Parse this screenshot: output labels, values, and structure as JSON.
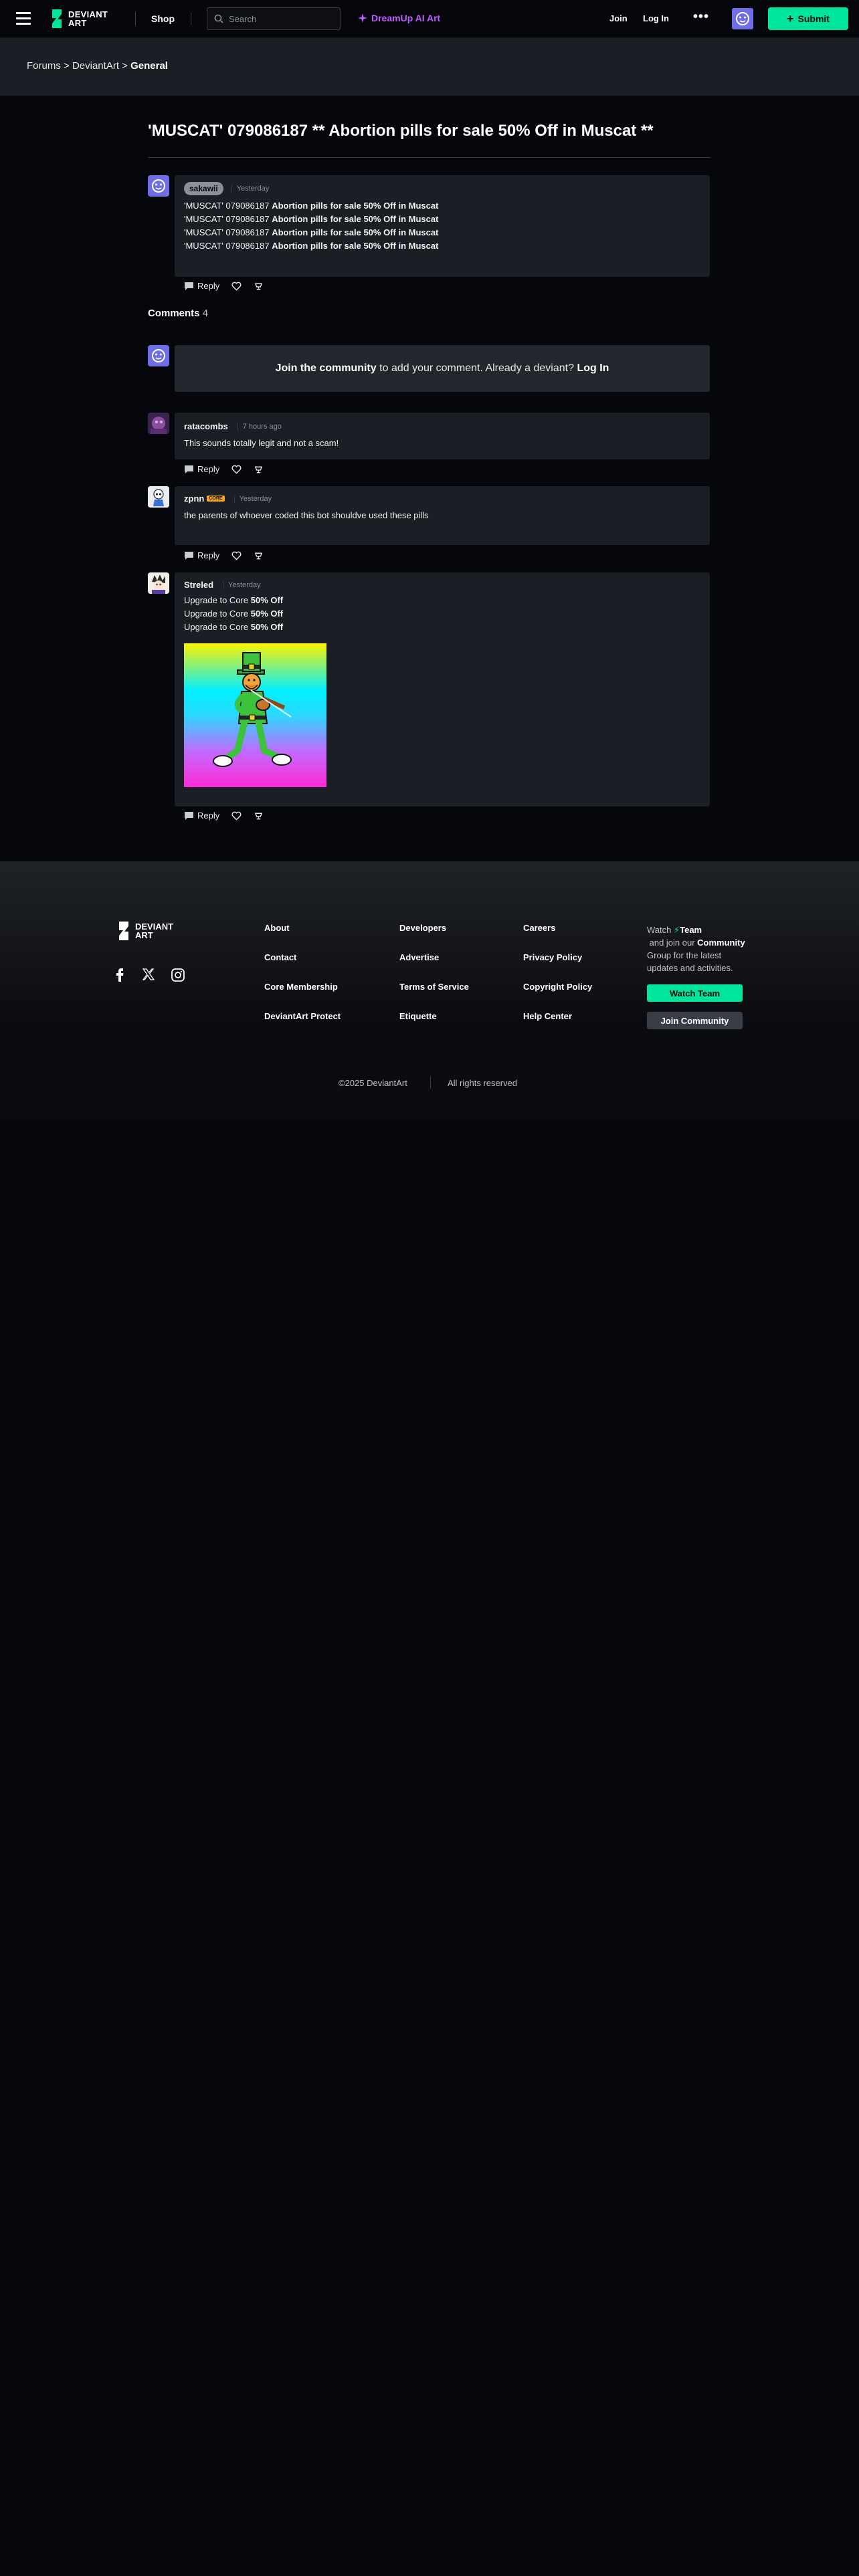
{
  "nav": {
    "shop": "Shop",
    "search_placeholder": "Search",
    "dreamup": "DreamUp AI Art",
    "join": "Join",
    "login": "Log In",
    "more": "•••",
    "submit": "Submit",
    "logo_line1": "DEVIANT",
    "logo_line2": "ART"
  },
  "breadcrumb": {
    "items": [
      "Forums",
      "DeviantArt"
    ],
    "sep": " > ",
    "current": "General"
  },
  "post": {
    "title": "'MUSCAT' 079086187 ** Abortion pills for sale 50% Off in Muscat **",
    "author": "sakawii",
    "time": "Yesterday",
    "lines": [
      {
        "prefix": "'MUSCAT' 079086187",
        "bold": "Abortion pills for sale 50% Off in Muscat"
      },
      {
        "prefix": "'MUSCAT' 079086187",
        "bold": "Abortion pills for sale 50% Off in Muscat"
      },
      {
        "prefix": "'MUSCAT' 079086187",
        "bold": "Abortion pills for sale 50% Off in Muscat"
      },
      {
        "prefix": "'MUSCAT' 079086187",
        "bold": "Abortion pills for sale 50% Off in Muscat"
      }
    ],
    "reply": "Reply"
  },
  "comments": {
    "heading": "Comments",
    "count": "4",
    "join_bold": "Join the community",
    "join_text": " to add your comment. Already a deviant? ",
    "join_login": "Log In",
    "items": [
      {
        "author": "ratacombs",
        "time": "7 hours ago",
        "text": "This sounds totally legit and not a scam!",
        "reply": "Reply"
      },
      {
        "author": "zpnn",
        "badge": "CORE",
        "time": "Yesterday",
        "text": "the parents of whoever coded this bot shouldve used these pills",
        "reply": "Reply"
      },
      {
        "author": "Streled",
        "time": "Yesterday",
        "lines": [
          {
            "prefix": "Upgrade to Core ",
            "bold": "50% Off"
          },
          {
            "prefix": "Upgrade to Core ",
            "bold": "50% Off"
          },
          {
            "prefix": "Upgrade to Core ",
            "bold": "50% Off"
          }
        ],
        "reply": "Reply"
      }
    ]
  },
  "footer": {
    "col1": [
      "About",
      "Contact",
      "Core Membership",
      "DeviantArt Protect"
    ],
    "col2": [
      "Developers",
      "Advertise",
      "Terms of Service",
      "Etiquette"
    ],
    "col3": [
      "Careers",
      "Privacy Policy",
      "Copyright Policy",
      "Help Center"
    ],
    "watch_a": "Watch ",
    "watch_team": "Team",
    "watch_b": " and join our ",
    "watch_community": "Community",
    "watch_c": " Group for the latest updates and activities.",
    "watch_team_btn": "Watch Team",
    "join_community_btn": "Join Community",
    "copyright": "©2025 DeviantArt",
    "rights": "All rights reserved"
  },
  "colors": {
    "accent": "#00e59b",
    "dreamup": "#c35cff",
    "background": "#06070d",
    "card": "#1b1e24"
  }
}
